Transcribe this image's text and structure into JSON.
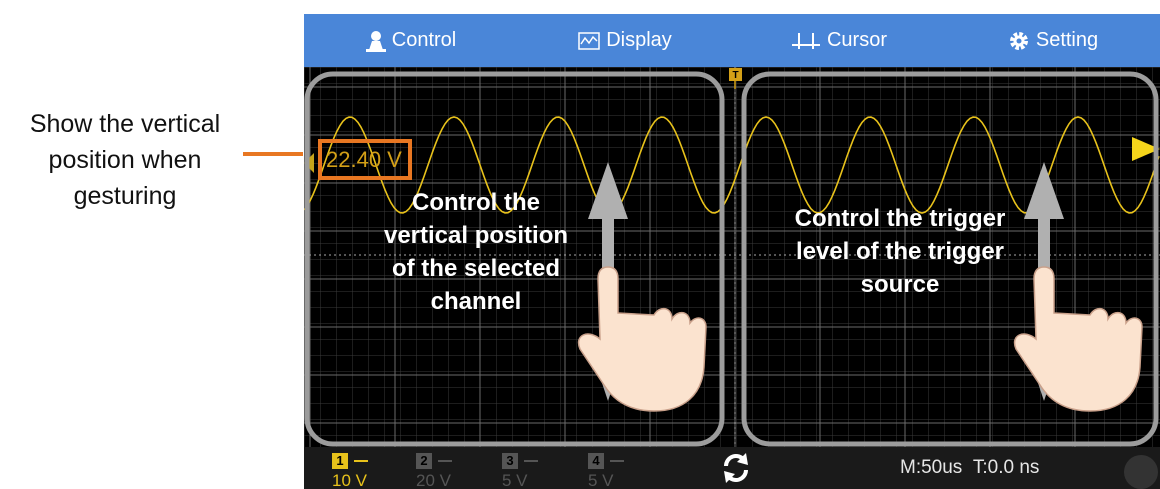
{
  "callout": {
    "lines": [
      "Show the vertical",
      "position when",
      "gesturing"
    ]
  },
  "menu": {
    "control": "Control",
    "display": "Display",
    "cursor": "Cursor",
    "setting": "Setting"
  },
  "readout": "22.40 V",
  "trigger_marker": "T",
  "left_gesture_text": [
    "Control the",
    "vertical position",
    "of the selected",
    "channel"
  ],
  "right_gesture_text": [
    "Control the trigger",
    "level of the trigger",
    "source"
  ],
  "channels": [
    {
      "num": "1",
      "volt": "10 V",
      "color": "#e8c21b",
      "active": true
    },
    {
      "num": "2",
      "volt": "20 V",
      "color": "#555555",
      "active": false
    },
    {
      "num": "3",
      "volt": "5 V",
      "color": "#555555",
      "active": false
    },
    {
      "num": "4",
      "volt": "5 V",
      "color": "#555555",
      "active": false
    }
  ],
  "status": {
    "timebase": "M:50us",
    "trigger_time": "T:0.0 ns"
  },
  "colors": {
    "topbar": "#4a86d8",
    "waveform": "#e8c21b",
    "callout_accent": "#e87722"
  }
}
